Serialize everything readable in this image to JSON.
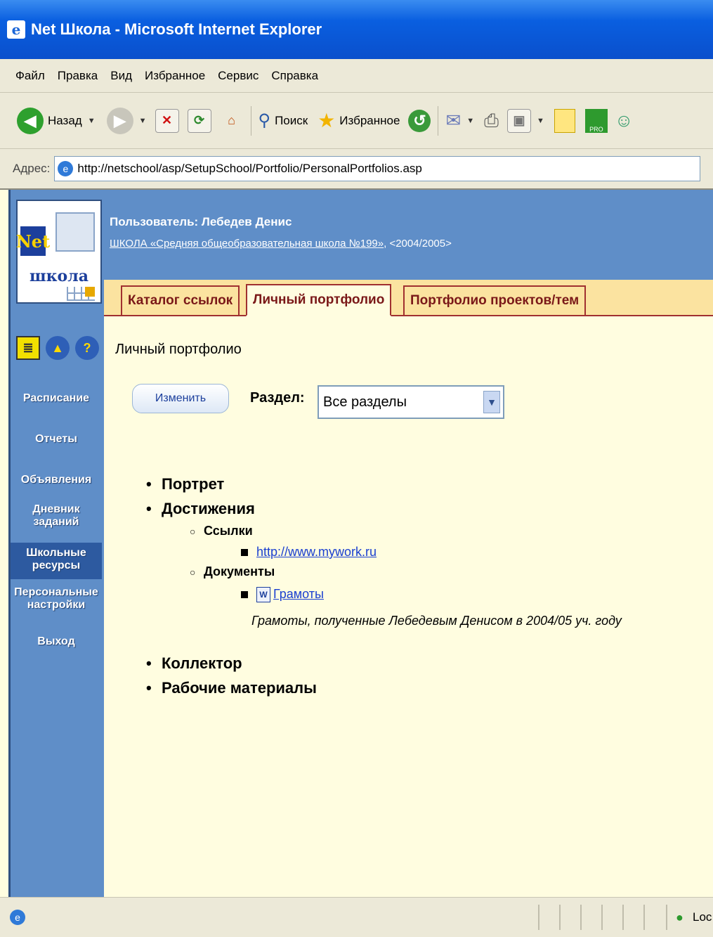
{
  "window": {
    "title": "Net Школа - Microsoft Internet Explorer"
  },
  "menubar": [
    "Файл",
    "Правка",
    "Вид",
    "Избранное",
    "Сервис",
    "Справка"
  ],
  "toolbar": {
    "back": "Назад",
    "search": "Поиск",
    "favorites": "Избранное"
  },
  "address": {
    "label": "Адрес:",
    "url": "http://netschool/asp/SetupSchool/Portfolio/PersonalPortfolios.asp"
  },
  "header": {
    "user": "Пользователь: Лебедев Денис",
    "school": "ШКОЛА «Средняя общеобразовательная школа №199»",
    "year": ", <2004/2005>"
  },
  "logo": {
    "net": "Net",
    "school": "школа"
  },
  "tabs": [
    {
      "label": "Каталог ссылок",
      "active": false
    },
    {
      "label": "Личный портфолио",
      "active": true
    },
    {
      "label": "Портфолио проектов/тем",
      "active": false
    }
  ],
  "sidebar": {
    "items": [
      {
        "label": "Расписание"
      },
      {
        "label": "Отчеты"
      },
      {
        "label": "Объявления"
      },
      {
        "label": "Дневник заданий"
      },
      {
        "label": "Школьные ресурсы",
        "active": true
      },
      {
        "label": "Персональные настройки"
      },
      {
        "label": "Выход"
      }
    ]
  },
  "main": {
    "title": "Личный портфолио",
    "edit_button": "Изменить",
    "section_label": "Раздел:",
    "section_value": "Все разделы",
    "tree": {
      "portrait": "Портрет",
      "achievements": "Достижения",
      "links": "Ссылки",
      "link_url": "http://www.mywork.ru",
      "documents": "Документы",
      "doc_name": "Грамоты",
      "doc_desc": "Грамоты, полученные Лебедевым Денисом в 2004/05 уч. году",
      "collector": "Коллектор",
      "materials": "Рабочие материалы"
    }
  },
  "status": {
    "zone": "Loc"
  },
  "colors": {
    "sidebar": "#5f8ec8",
    "content_bg": "#fffde0",
    "tab_text": "#7a1818",
    "link": "#1a3fd0"
  }
}
